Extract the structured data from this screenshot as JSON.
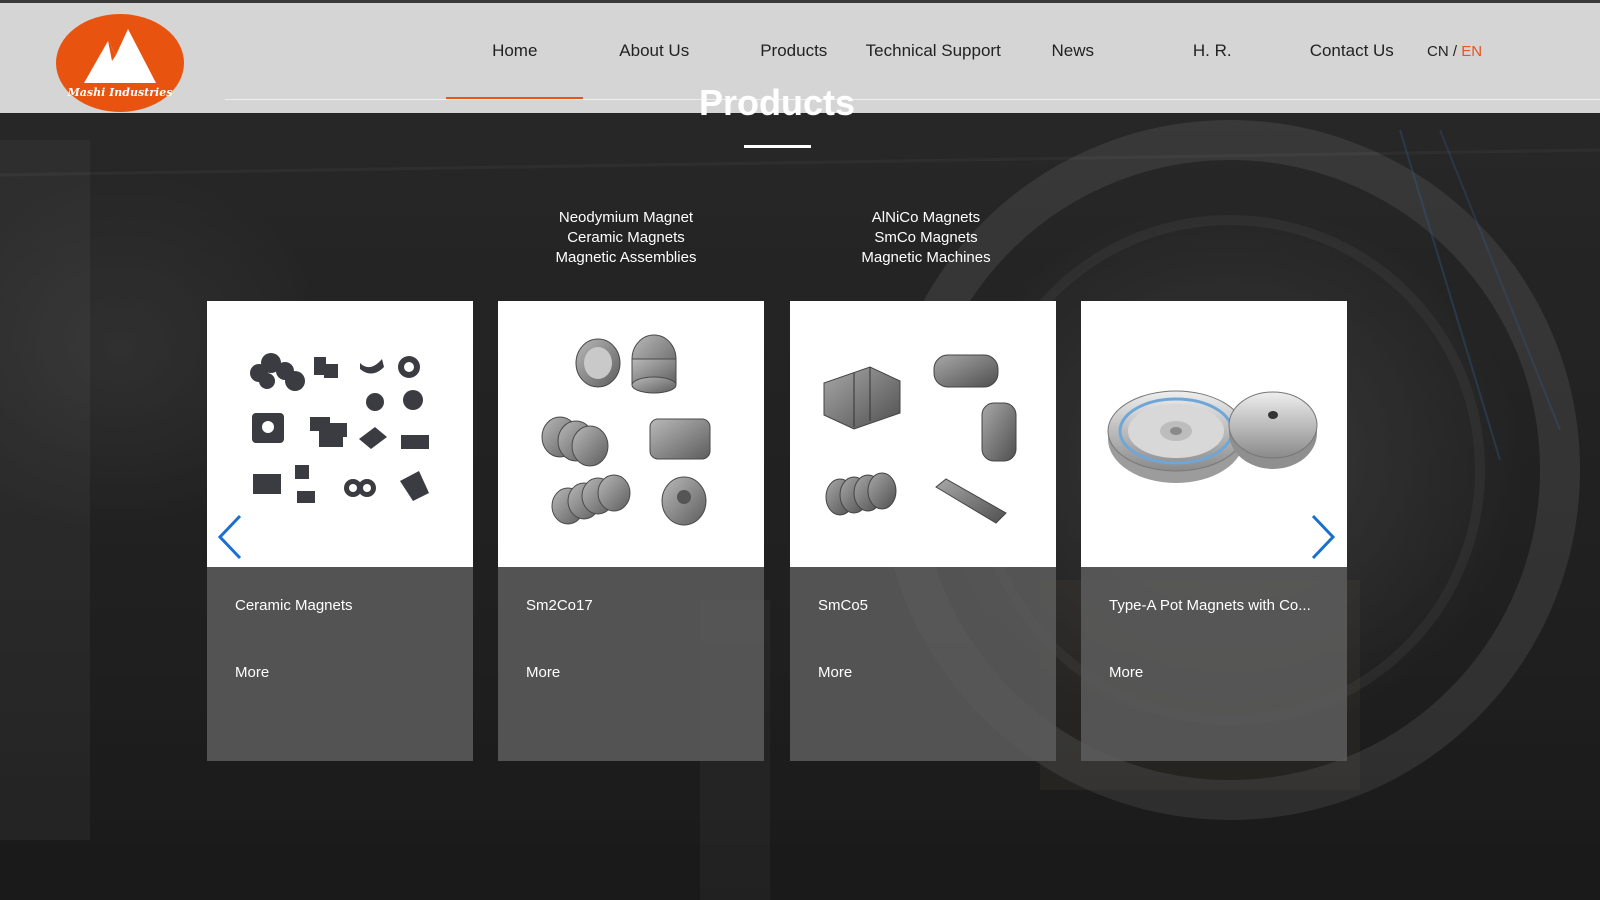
{
  "header": {
    "logo_text": "Mashi Industries",
    "nav": [
      "Home",
      "About Us",
      "Products",
      "Technical Support",
      "News",
      "H. R.",
      "Contact Us"
    ],
    "active_nav": "Home",
    "lang_cn": "CN",
    "lang_sep": " / ",
    "lang_en": "EN"
  },
  "section": {
    "title": "Products",
    "categories_left": [
      "Neodymium Magnet",
      "Ceramic Magnets",
      "Magnetic Assemblies"
    ],
    "categories_right": [
      "AlNiCo Magnets",
      "SmCo Magnets",
      "Magnetic Machines"
    ]
  },
  "products": [
    {
      "name": "Ceramic Magnets",
      "more": "More"
    },
    {
      "name": "Sm2Co17",
      "more": "More"
    },
    {
      "name": "SmCo5",
      "more": "More"
    },
    {
      "name": "Type-A Pot Magnets with Co...",
      "more": "More"
    }
  ],
  "colors": {
    "accent": "#e8541c",
    "logo": "#e85310",
    "arrow": "#1a6fd0"
  },
  "icons": {
    "prev": "chevron-left-icon",
    "next": "chevron-right-icon"
  }
}
